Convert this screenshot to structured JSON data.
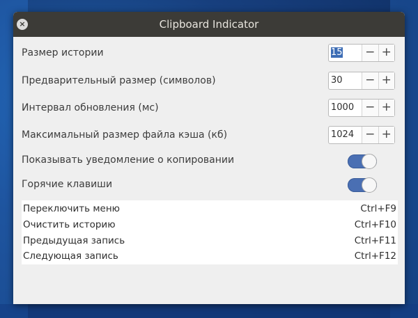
{
  "window": {
    "title": "Clipboard Indicator"
  },
  "settings": {
    "history_size": {
      "label": "Размер истории",
      "value": "15",
      "selected": true
    },
    "preview_size": {
      "label": "Предварительный размер (символов)",
      "value": "30"
    },
    "refresh_interval": {
      "label": "Интервал обновления (мс)",
      "value": "1000"
    },
    "cache_file_size": {
      "label": "Максимальный размер файла кэша (кб)",
      "value": "1024"
    },
    "notify_on_copy": {
      "label": "Показывать уведомление о копировании",
      "state": "on"
    },
    "hotkeys": {
      "label": "Горячие клавиши",
      "state": "on"
    }
  },
  "spin_buttons": {
    "minus": "−",
    "plus": "+"
  },
  "shortcuts": [
    {
      "action": "Переключить меню",
      "keys": "Ctrl+F9"
    },
    {
      "action": "Очистить историю",
      "keys": "Ctrl+F10"
    },
    {
      "action": "Предыдущая запись",
      "keys": "Ctrl+F11"
    },
    {
      "action": "Следующая запись",
      "keys": "Ctrl+F12"
    }
  ],
  "icons": {
    "close": "×"
  },
  "colors": {
    "titlebar": "#3c3b37",
    "window_bg": "#efefef",
    "accent": "#4a6fb3",
    "selection": "#3d6db5"
  }
}
